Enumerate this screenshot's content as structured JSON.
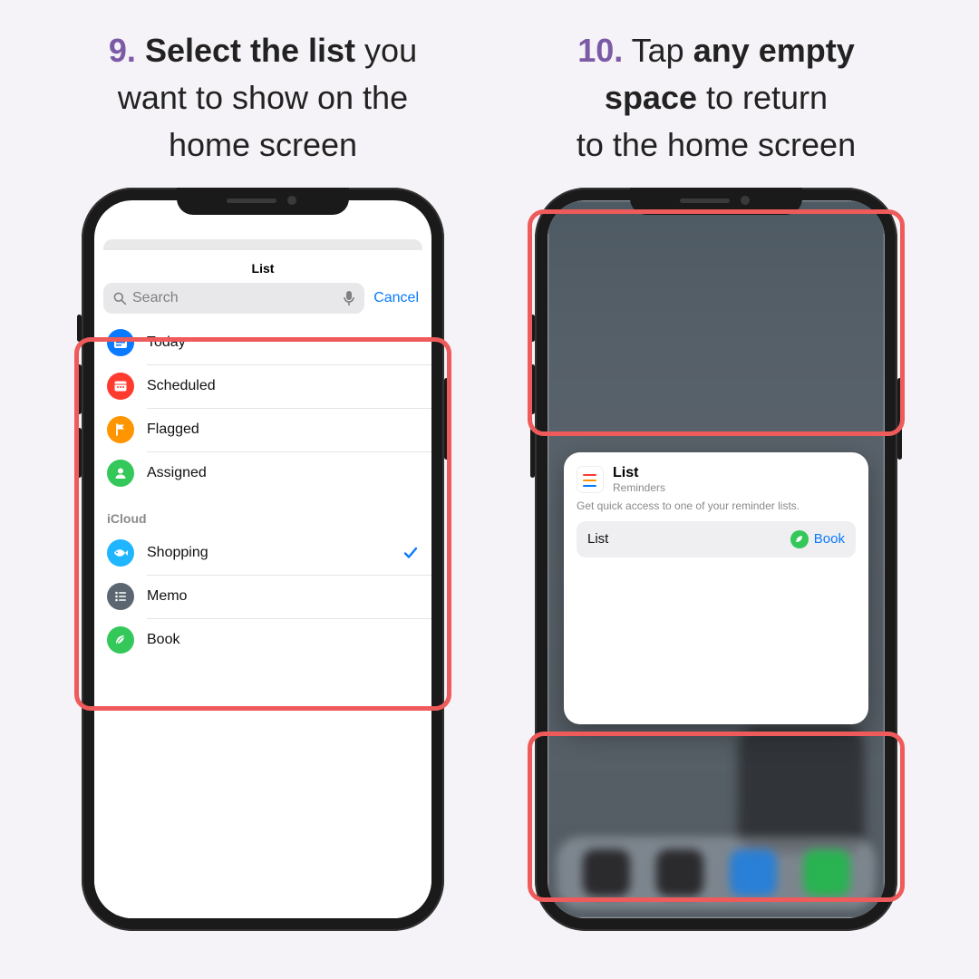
{
  "step9": {
    "num": "9.",
    "caption_bold": "Select the list",
    "caption_rest1": " you",
    "caption_line2": "want to show on the",
    "caption_line3": "home screen"
  },
  "step10": {
    "num": "10.",
    "caption_rest1": " Tap ",
    "caption_bold": "any empty",
    "caption_bold2": "space",
    "caption_rest2": " to return",
    "caption_line3": "to the home screen"
  },
  "screen1": {
    "sheet_title": "List",
    "search_placeholder": "Search",
    "cancel": "Cancel",
    "items": [
      {
        "label": "Today",
        "color": "#0a7aff",
        "icon": "today"
      },
      {
        "label": "Scheduled",
        "color": "#ff3b30",
        "icon": "calendar"
      },
      {
        "label": "Flagged",
        "color": "#ff9500",
        "icon": "flag"
      },
      {
        "label": "Assigned",
        "color": "#34c759",
        "icon": "person"
      }
    ],
    "section_header": "iCloud",
    "cloud_items": [
      {
        "label": "Shopping",
        "color": "#1fb6ff",
        "icon": "fish",
        "checked": true
      },
      {
        "label": "Memo",
        "color": "#5b6670",
        "icon": "list"
      },
      {
        "label": "Book",
        "color": "#34c759",
        "icon": "leaf"
      }
    ]
  },
  "screen2": {
    "pop_title": "List",
    "pop_sub": "Reminders",
    "pop_desc": "Get quick access to one of your reminder lists.",
    "row_key": "List",
    "row_val": "Book"
  },
  "colors": {
    "highlight": "#ef5a5a",
    "ios_blue": "#0a7aff"
  }
}
